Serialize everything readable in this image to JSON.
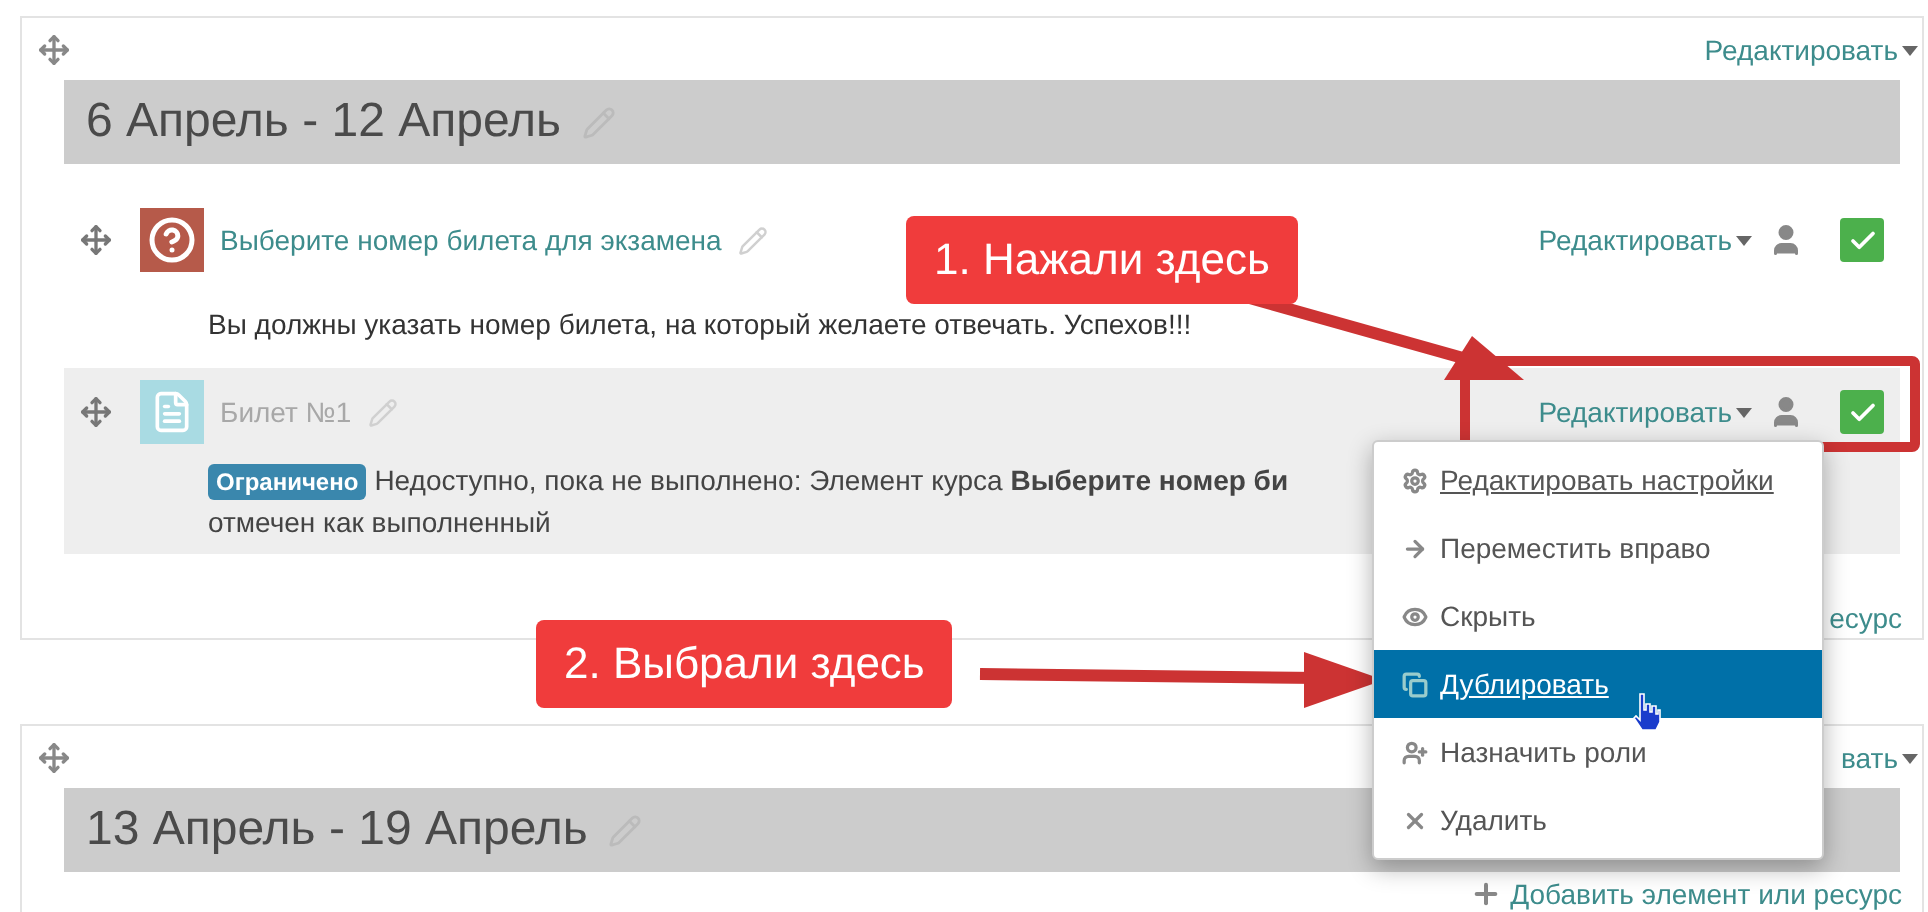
{
  "sections": [
    {
      "edit_label": "Редактировать",
      "title": "6 Апрель - 12 Апрель",
      "activities": [
        {
          "kind": "quiz",
          "name": "Выберите номер билета для экзамена",
          "dimmed": false,
          "edit_label": "Редактировать",
          "completed": true,
          "description": "Вы должны указать номер билета, на который желаете отвечать. Успехов!!!"
        },
        {
          "kind": "assignment",
          "name": "Билет №1",
          "dimmed": true,
          "edit_label": "Редактировать",
          "completed": true,
          "badge": "Ограничено",
          "restriction": "Недоступно, пока не выполнено: Элемент курса **Выберите номер би**",
          "restriction_end": "отмечен как выполненный"
        }
      ],
      "add_label": "есурс"
    },
    {
      "edit_label": "вать",
      "title": "13 Апрель - 19 Апрель",
      "add_label": "Добавить элемент или ресурс"
    }
  ],
  "menu": [
    {
      "label": "Редактировать настройки",
      "selected": false
    },
    {
      "label": "Переместить вправо",
      "selected": false
    },
    {
      "label": "Скрыть",
      "selected": false
    },
    {
      "label": "Дублировать",
      "selected": true
    },
    {
      "label": "Назначить роли",
      "selected": false
    },
    {
      "label": "Удалить",
      "selected": false
    }
  ],
  "callouts": [
    {
      "text": "1. Нажали здесь"
    },
    {
      "text": "2. Выбрали здесь"
    }
  ]
}
